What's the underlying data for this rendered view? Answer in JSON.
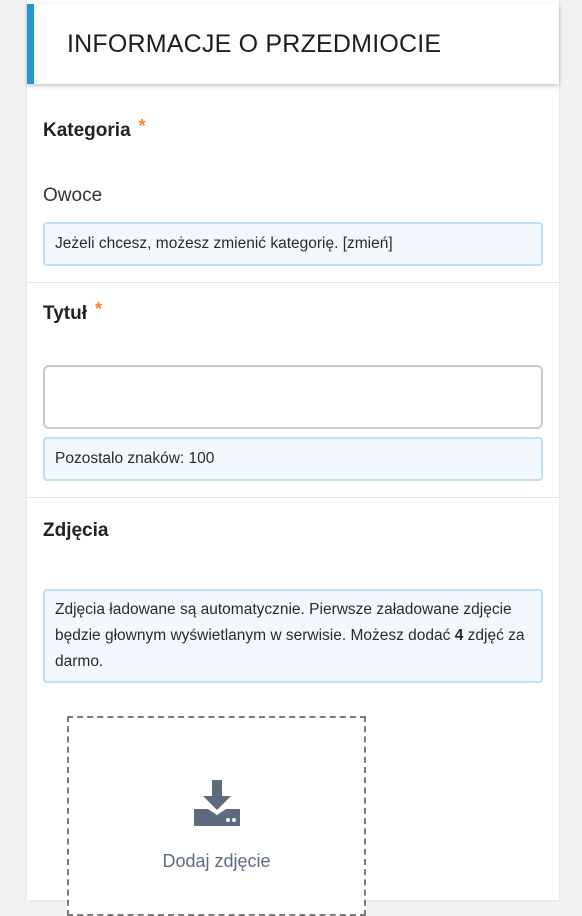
{
  "header": {
    "title": "INFORMACJE O PRZEDMIOCIE"
  },
  "category": {
    "label": "Kategoria",
    "required_mark": "*",
    "value": "Owoce",
    "info": "Jeżeli chcesz, możesz zmienić kategorię. [zmień]"
  },
  "title_field": {
    "label": "Tytuł",
    "required_mark": "*",
    "value": "",
    "placeholder": "",
    "counter": "Pozostalo znaków: 100"
  },
  "photos": {
    "label": "Zdjęcia",
    "info_part1": "Zdjęcia ładowane są automatycznie. Pierwsze załadowane zdjęcie będzie głownym wyświetlanym w serwisie. Możesz dodać ",
    "info_count": "4",
    "info_part2": " zdjęć za darmo.",
    "upload_label": "Dodaj zdjęcie",
    "upload_icon": "download-tray-icon"
  },
  "colors": {
    "accent": "#2196d3",
    "required": "#ff7f1f",
    "info_bg": "#f2f8fd",
    "info_border": "#bfdff3",
    "icon": "#5e6b7e"
  }
}
